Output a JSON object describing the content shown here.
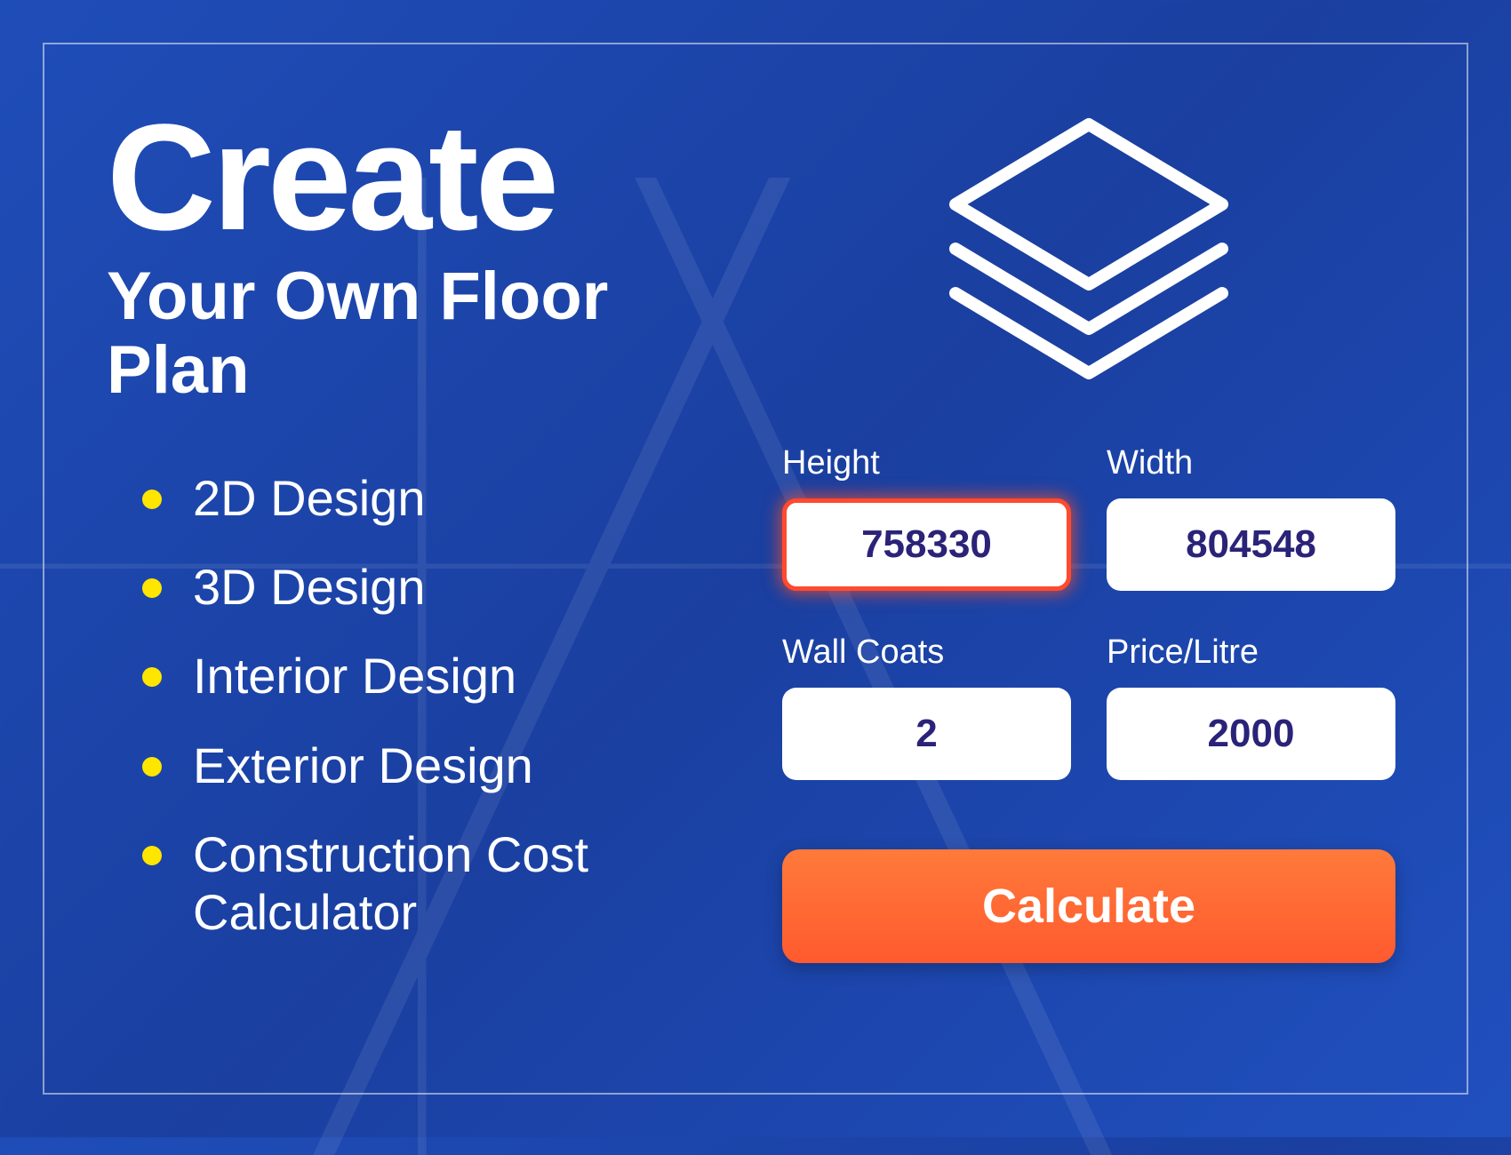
{
  "hero": {
    "title": "Create",
    "subtitle": "Your Own Floor Plan"
  },
  "features": [
    "2D Design",
    "3D Design",
    "Interior Design",
    "Exterior Design",
    "Construction Cost Calculator"
  ],
  "form": {
    "height": {
      "label": "Height",
      "value": "758330"
    },
    "width": {
      "label": "Width",
      "value": "804548"
    },
    "coats": {
      "label": "Wall Coats",
      "value": "2"
    },
    "price": {
      "label": "Price/Litre",
      "value": "2000"
    },
    "submit_label": "Calculate"
  },
  "colors": {
    "accent_yellow": "#ffe600",
    "accent_orange": "#ff5a2e",
    "input_text": "#2a2378",
    "bg_blue": "#1d48b0"
  }
}
